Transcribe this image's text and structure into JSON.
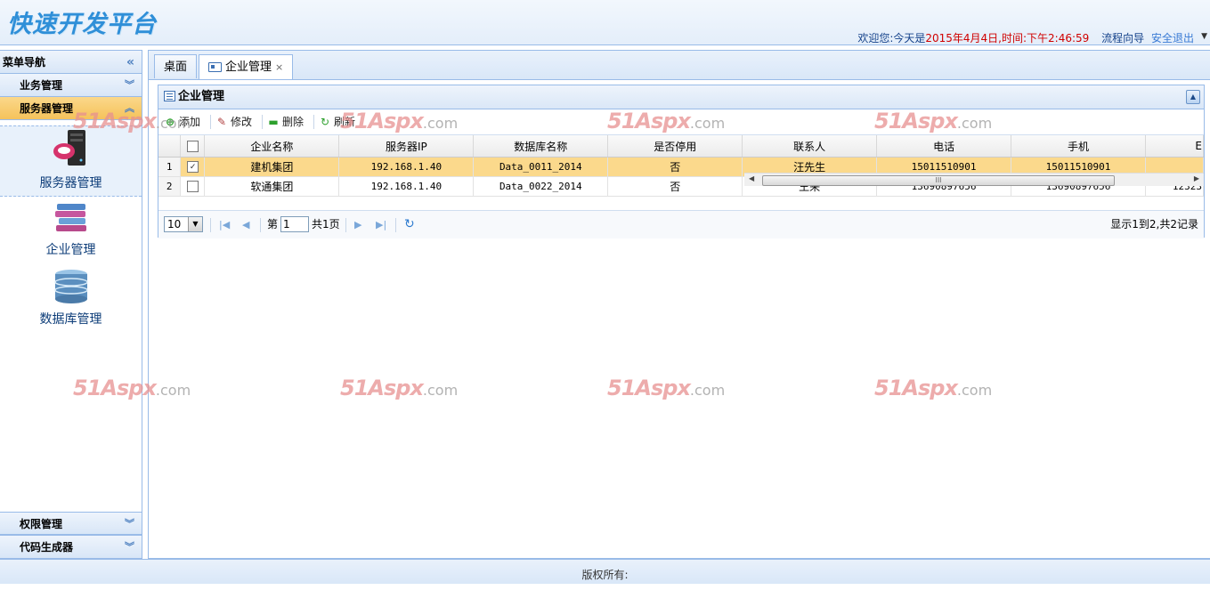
{
  "app": {
    "title": "快速开发平台"
  },
  "header": {
    "welcome_label": "欢迎您:今天是",
    "datetime": "2015年4月4日,时间:下午2:46:59",
    "workflow_link": "流程向导",
    "logout_link": "安全退出"
  },
  "sidebar": {
    "title": "菜单导航",
    "sections": [
      {
        "label": "业务管理"
      },
      {
        "label": "服务器管理"
      },
      {
        "label": "权限管理"
      },
      {
        "label": "代码生成器"
      }
    ],
    "items": [
      {
        "label": "服务器管理",
        "icon": "server-icon"
      },
      {
        "label": "企业管理",
        "icon": "books-icon"
      },
      {
        "label": "数据库管理",
        "icon": "database-icon"
      }
    ]
  },
  "tabs": [
    {
      "label": "桌面"
    },
    {
      "label": "企业管理",
      "close": "×"
    }
  ],
  "grid": {
    "title": "企业管理",
    "toolbar": {
      "add": "添加",
      "edit": "修改",
      "delete": "删除",
      "refresh": "刷新"
    },
    "columns": [
      "企业名称",
      "服务器IP",
      "数据库名称",
      "是否停用",
      "联系人",
      "电话",
      "手机",
      "E"
    ],
    "rows": [
      {
        "num": "1",
        "checked": true,
        "company": "建机集团",
        "ip": "192.168.1.40",
        "db": "Data_0011_2014",
        "disabled": "否",
        "contact": "汪先生",
        "phone": "15011510901",
        "mobile": "15011510901",
        "extra": ""
      },
      {
        "num": "2",
        "checked": false,
        "company": "软通集团",
        "ip": "192.168.1.40",
        "db": "Data_0022_2014",
        "disabled": "否",
        "contact": "王来",
        "phone": "13690897656",
        "mobile": "13690897656",
        "extra": "12323"
      }
    ],
    "pager": {
      "page_size": "10",
      "page_pre": "第",
      "page_value": "1",
      "page_post": "共1页",
      "record_info": "显示1到2,共2记录"
    }
  },
  "watermark": {
    "brand": "51Aspx",
    "suffix": ".com"
  },
  "footer": {
    "text": "版权所有:"
  },
  "colors": {
    "accent": "#15428b",
    "border": "#99bbe8",
    "selected_row": "#fbd98c",
    "time_red": "#d00000"
  }
}
